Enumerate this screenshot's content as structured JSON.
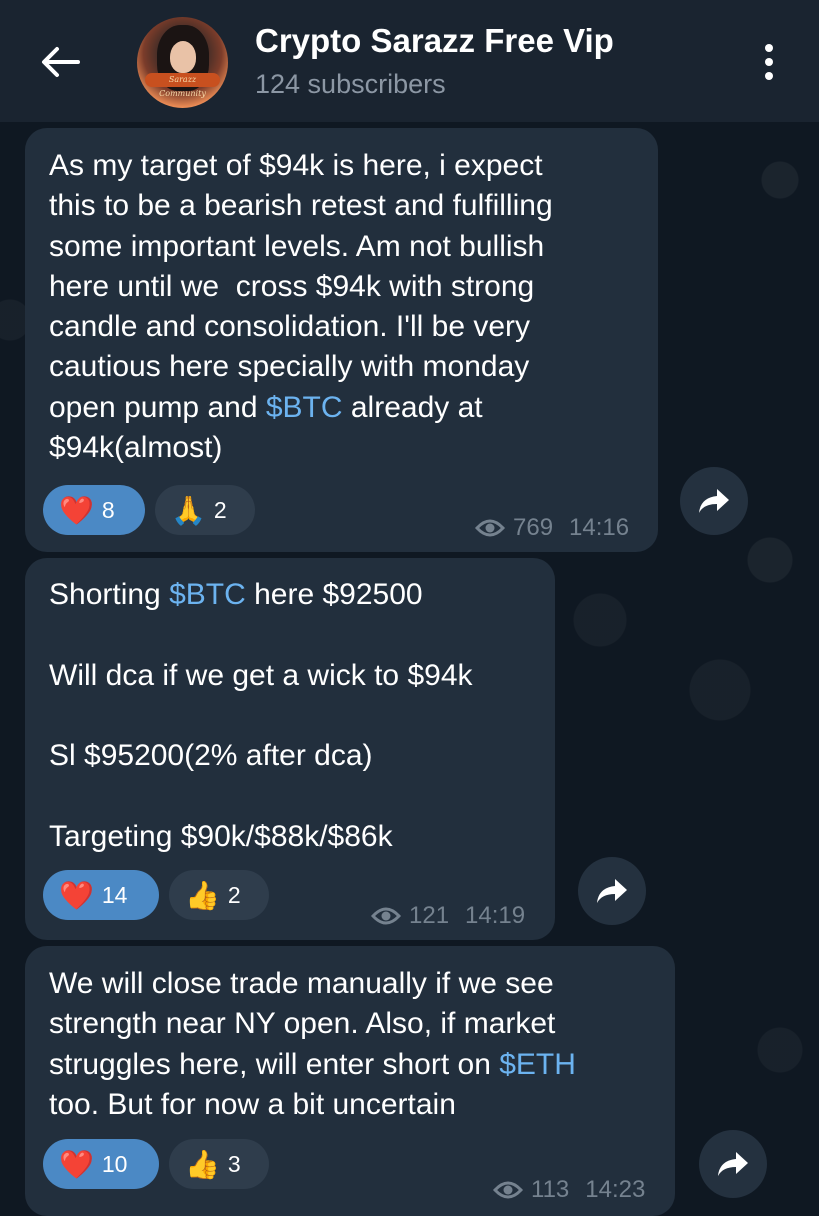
{
  "header": {
    "title": "Crypto Sarazz Free Vip",
    "subscribers": "124 subscribers",
    "avatar_text": "Sarazz Community"
  },
  "colors": {
    "background": "#0f1822",
    "header": "#1a2430",
    "bubble": "#222f3d",
    "accent_link": "#6cb3f0",
    "reaction_active": "#4b89c5",
    "meta": "#75828f"
  },
  "messages": [
    {
      "text_before": "As my target of $94k is here, i expect\nthis to be a bearish retest and fulfilling\nsome important levels. Am not bullish\nhere until we  cross $94k with strong\ncandle and consolidation. I'll be very\ncautious here specially with monday\nopen pump and ",
      "tag": "$BTC",
      "text_after": " already at\n$94k(almost)",
      "reactions": [
        {
          "icon": "heart-icon",
          "emoji": "❤️",
          "count": "8"
        },
        {
          "icon": "praying-hands-icon",
          "emoji": "🙏",
          "count": "2"
        }
      ],
      "views": "769",
      "time": "14:16"
    },
    {
      "text_before": "Shorting ",
      "tag": "$BTC",
      "text_after": " here $92500\n\nWill dca if we get a wick to $94k\n\nSl $95200(2% after dca)\n\nTargeting $90k/$88k/$86k",
      "reactions": [
        {
          "icon": "heart-icon",
          "emoji": "❤️",
          "count": "14"
        },
        {
          "icon": "thumbs-up-icon",
          "emoji": "👍",
          "count": "2"
        }
      ],
      "views": "121",
      "time": "14:19"
    },
    {
      "text_before": "We will close trade manually if we see\nstrength near NY open. Also, if market\nstruggles here, will enter short on ",
      "tag": "$ETH",
      "text_after": "\ntoo. But for now a bit uncertain",
      "reactions": [
        {
          "icon": "heart-icon",
          "emoji": "❤️",
          "count": "10"
        },
        {
          "icon": "thumbs-up-icon",
          "emoji": "👍",
          "count": "3"
        }
      ],
      "views": "113",
      "time": "14:23"
    }
  ]
}
